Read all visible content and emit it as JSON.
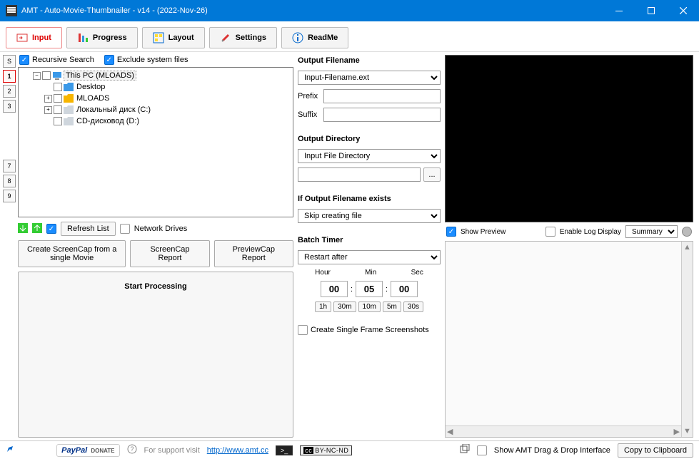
{
  "window": {
    "title": "AMT - Auto-Movie-Thumbnailer - v14 - (2022-Nov-26)"
  },
  "tabs": {
    "input": "Input",
    "progress": "Progress",
    "layout": "Layout",
    "settings": "Settings",
    "readme": "ReadMe"
  },
  "side_slots": [
    "S",
    "1",
    "2",
    "3",
    "",
    "",
    "",
    "7",
    "8",
    "9"
  ],
  "tree_options": {
    "recursive": "Recursive Search",
    "exclude_system": "Exclude system files"
  },
  "tree": {
    "root": "This PC (MLOADS)",
    "children": [
      {
        "label": "Desktop",
        "color": "#3b99e8",
        "expandable": false
      },
      {
        "label": "MLOADS",
        "color": "#f7b500",
        "expandable": true
      },
      {
        "label": "Локальный диск (C:)",
        "color": "#cfd6dd",
        "expandable": true
      },
      {
        "label": "CD-дисковод (D:)",
        "color": "#cfd6dd",
        "expandable": false
      }
    ]
  },
  "below_tree": {
    "refresh": "Refresh List",
    "network_drives": "Network Drives",
    "create_single": "Create ScreenCap from a single Movie",
    "screencap_report": "ScreenCap\nReport",
    "previewcap_report": "PreviewCap\nReport",
    "start": "Start Processing"
  },
  "output_filename": {
    "label": "Output Filename",
    "select_value": "Input-Filename.ext",
    "prefix_label": "Prefix",
    "prefix_value": "",
    "suffix_label": "Suffix",
    "suffix_value": ""
  },
  "output_directory": {
    "label": "Output Directory",
    "select_value": "Input File Directory",
    "path_value": "",
    "browse": "..."
  },
  "if_exists": {
    "label": "If Output Filename exists",
    "select_value": "Skip creating file"
  },
  "batch_timer": {
    "label": "Batch Timer",
    "select_value": "Restart after",
    "hour_label": "Hour",
    "min_label": "Min",
    "sec_label": "Sec",
    "hour": "00",
    "min": "05",
    "sec": "00",
    "quick": [
      "1h",
      "30m",
      "10m",
      "5m",
      "30s"
    ]
  },
  "single_frame": {
    "label": "Create Single Frame Screenshots"
  },
  "preview_panel": {
    "show_preview": "Show Preview",
    "enable_log": "Enable Log Display",
    "mode_value": "Summary"
  },
  "statusbar": {
    "support_text": "For support visit",
    "support_url": "http://www.amt.cc",
    "cc": "BY-NC-ND",
    "cc_prefix": "cc",
    "show_dnd": "Show AMT Drag & Drop Interface",
    "copy": "Copy to Clipboard",
    "paypal": "PayPal",
    "donate": "DONATE"
  }
}
